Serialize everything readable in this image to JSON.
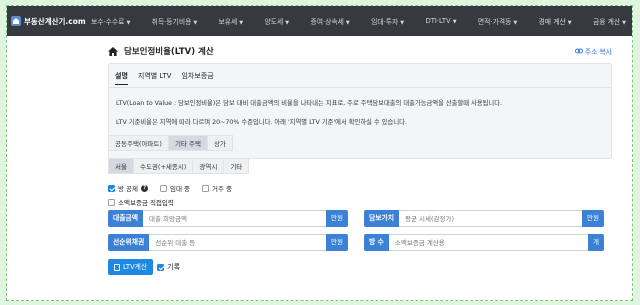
{
  "brand": {
    "name": "부동산계산기.com",
    "logo_icon": "house-logo-icon"
  },
  "nav": [
    {
      "label": "보수·수수료"
    },
    {
      "label": "취득·등기비용"
    },
    {
      "label": "보유세"
    },
    {
      "label": "양도세"
    },
    {
      "label": "증여·상속세"
    },
    {
      "label": "임대·투자"
    },
    {
      "label": "DTI·LTV"
    },
    {
      "label": "면적·가격등"
    },
    {
      "label": "경매 계산"
    },
    {
      "label": "금융 계산"
    }
  ],
  "page": {
    "title": "담보인정비율(LTV) 계산",
    "copy_address": "주소 복사"
  },
  "tabs": [
    {
      "label": "설명"
    },
    {
      "label": "지역별 LTV"
    },
    {
      "label": "임차보증금"
    }
  ],
  "description": {
    "line1": "LTV(Loan to Value : 담보인정비율)은 담보 대비 대출금액의 비율을 나타내는 지표로, 주로 주택담보대출의 대출가능금액을 산출할때 사용됩니다.",
    "line2": "LTV 기준비율은 지역에 따라 다르며 20~70% 수준입니다. 아래 '지역별 LTV 기준'에서 확인하실 수 있습니다."
  },
  "property_type": {
    "options": [
      "공동주택(아파트)",
      "기타 주택",
      "상가"
    ],
    "selected": "기타 주택"
  },
  "region": {
    "options": [
      "서울",
      "수도권(+세종시)",
      "광역시",
      "기타"
    ],
    "selected": "서울"
  },
  "options": {
    "no_home_change": "방 공제",
    "rental_house": "임대 중",
    "residing": "거주 중",
    "small_deposit": "소액보증금 직접입력"
  },
  "fields": {
    "loan_amount": {
      "label": "대출금액",
      "placeholder": "대출 희망금액",
      "unit": "만원"
    },
    "collateral_value": {
      "label": "담보가치",
      "placeholder": "평균 시세(감정가)",
      "unit": "만원"
    },
    "senior_lien": {
      "label": "선순위채권",
      "placeholder": "선순위 대출 등",
      "unit": "만원"
    },
    "room_count": {
      "label": "방 수",
      "placeholder": "소액보증금 계산용",
      "unit": "개"
    }
  },
  "actions": {
    "calculate": "LTV계산",
    "record": "기록"
  },
  "colors": {
    "nav_bg": "#343a40",
    "accent": "#3b82d6",
    "button": "#1e88e5",
    "frame": "#dff5de"
  }
}
